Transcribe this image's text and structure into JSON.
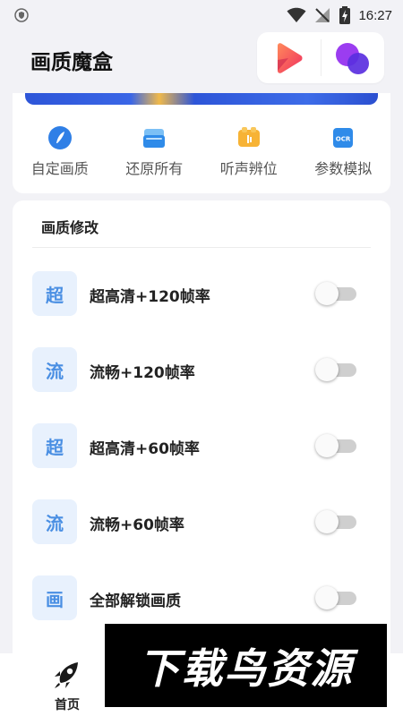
{
  "status_bar": {
    "time": "16:27"
  },
  "header": {
    "title": "画质魔盒",
    "play_icon": "play-icon",
    "circles_icon": "circles-icon"
  },
  "quick_actions": [
    {
      "label": "自定画质",
      "icon": "brush-icon"
    },
    {
      "label": "还原所有",
      "icon": "restore-icon"
    },
    {
      "label": "听声辨位",
      "icon": "sound-icon"
    },
    {
      "label": "参数模拟",
      "icon": "ocr-icon"
    }
  ],
  "ocr_text": "OCR",
  "section": {
    "title": "画质修改",
    "options": [
      {
        "badge": "超",
        "label": "超高清+120帧率",
        "enabled": false
      },
      {
        "badge": "流",
        "label": "流畅+120帧率",
        "enabled": false
      },
      {
        "badge": "超",
        "label": "超高清+60帧率",
        "enabled": false
      },
      {
        "badge": "流",
        "label": "流畅+60帧率",
        "enabled": false
      },
      {
        "badge": "画",
        "label": "全部解锁画质",
        "enabled": false
      }
    ]
  },
  "bottom_nav": {
    "home_label": "首页",
    "active": "首页"
  },
  "watermark": "下载鸟资源",
  "colors": {
    "accent": "#4a8fe3",
    "badge_bg": "#e8f1fd",
    "page_bg": "#f2f2f6"
  }
}
